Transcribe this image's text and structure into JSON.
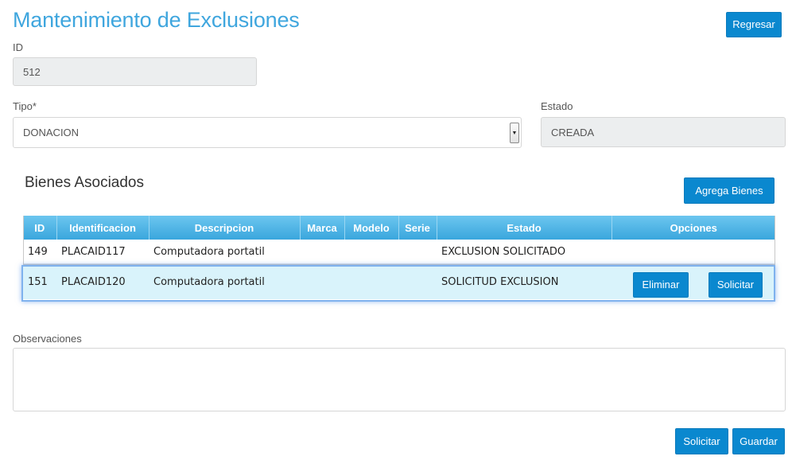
{
  "page": {
    "title": "Mantenimiento de Exclusiones",
    "back_button": "Regresar"
  },
  "form": {
    "id_label": "ID",
    "id_value": "512",
    "tipo_label": "Tipo",
    "tipo_required": "*",
    "tipo_value": "DONACION",
    "estado_label": "Estado",
    "estado_value": "CREADA"
  },
  "bienes": {
    "title": "Bienes Asociados",
    "add_button": "Agrega Bienes",
    "columns": [
      "ID",
      "Identificacion",
      "Descripcion",
      "Marca",
      "Modelo",
      "Serie",
      "Estado",
      "Opciones"
    ],
    "rows": [
      {
        "id": "149",
        "identificacion": "PLACAID117",
        "descripcion": "Computadora portatil",
        "marca": "",
        "modelo": "",
        "serie": "",
        "estado": "EXCLUSION SOLICITADO",
        "selected": false
      },
      {
        "id": "151",
        "identificacion": "PLACAID120",
        "descripcion": "Computadora portatil",
        "marca": "",
        "modelo": "",
        "serie": "",
        "estado": "SOLICITUD EXCLUSION",
        "selected": true,
        "eliminar_button": "Eliminar",
        "solicitar_button": "Solicitar"
      }
    ]
  },
  "observaciones": {
    "label": "Observaciones",
    "value": ""
  },
  "footer": {
    "solicitar_button": "Solicitar",
    "guardar_button": "Guardar"
  },
  "colors": {
    "accent": "#0a88cf",
    "title": "#3fa6de",
    "header_gradient_top": "#6cc6ef",
    "header_gradient_bottom": "#3aa6dd",
    "selected_row": "#d9f3fb"
  }
}
